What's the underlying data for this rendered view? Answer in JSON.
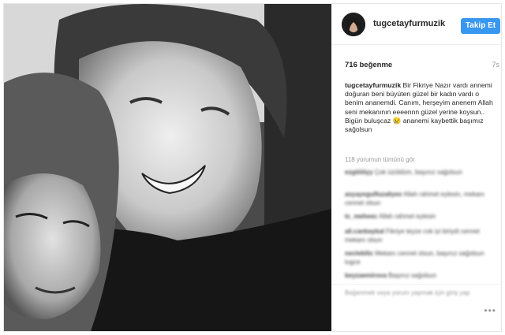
{
  "post": {
    "username": "tugcetayfurmuzik",
    "follow_label": "Takip Et",
    "likes": "716 beğenme",
    "time_ago": "7s",
    "caption_user": "tugcetayfurmuzik",
    "caption_text": " Bir Fikriye Nazır vardı annemi doğuran beni büyüten güzel bir kadın vardı o benim ananemdi. Canım, herşeyim anenem Allah seni mekanının eeeennn güzel yerine koysun.. Bigün buluşcaz 😢 ananemi kaybettik başımız sağolsun",
    "view_all_comments": "118 yorumun tümünü gör"
  },
  "comments": [
    {
      "user": "ezgiiiiiiyy",
      "text": "Çok üzüldüm, başınız sağolsun"
    },
    {
      "user": "asyayegulfuzaliyev",
      "text": "Allah rahmet eylesin, mekanı cennet olsun"
    },
    {
      "user": "tc_meheec",
      "text": "Allah rahmet eylesin"
    },
    {
      "user": "ali.canbaykal",
      "text": "Fikriye teyze cok iyi biriydi cennet mekanı olsun"
    },
    {
      "user": "neclekilic",
      "text": "Mekanı cennet olsun, başınız sağolsun tugce"
    },
    {
      "user": "beyzaemirova",
      "text": "Başınız sağolsun"
    }
  ],
  "footer": {
    "add_comment_placeholder": "Beğenmek veya yorum yapmak için giriş yap"
  },
  "icons": {
    "more": "more-options-icon"
  }
}
